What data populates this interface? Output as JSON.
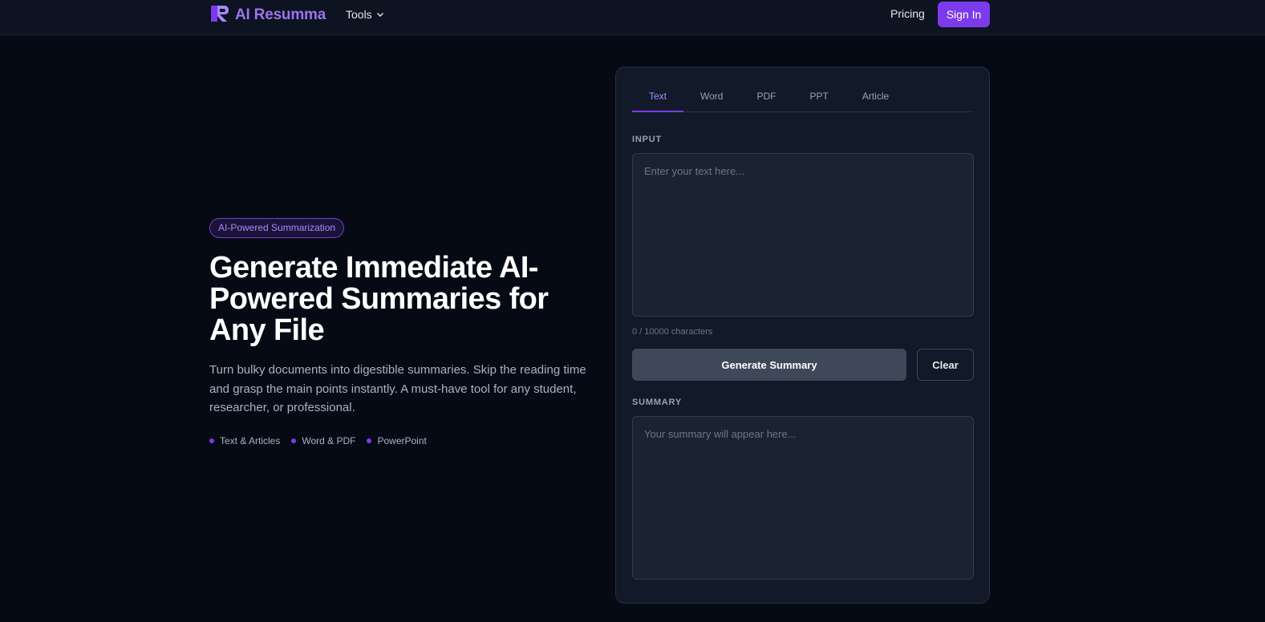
{
  "header": {
    "brand": "AI Resumma",
    "brand_icon": "logo-icon",
    "tools_label": "Tools",
    "pricing_label": "Pricing",
    "signin_label": "Sign In"
  },
  "hero": {
    "badge": "AI-Powered Summarization",
    "title": "Generate Immediate AI-Powered Summaries for Any File",
    "description": "Turn bulky documents into digestible summaries. Skip the reading time and grasp the main points instantly. A must-have tool for any student, researcher, or professional.",
    "features": [
      "Text & Articles",
      "Word & PDF",
      "PowerPoint"
    ]
  },
  "card": {
    "tabs": [
      "Text",
      "Word",
      "PDF",
      "PPT",
      "Article"
    ],
    "active_tab": "Text",
    "input_label": "INPUT",
    "input_placeholder": "Enter your text here...",
    "input_value": "",
    "char_count": "0 / 10000 characters",
    "generate_label": "Generate Summary",
    "clear_label": "Clear",
    "summary_label": "SUMMARY",
    "summary_placeholder": "Your summary will appear here...",
    "summary_value": ""
  },
  "colors": {
    "accent": "#7c3aed",
    "background": "#060a14",
    "card": "#121a29"
  }
}
